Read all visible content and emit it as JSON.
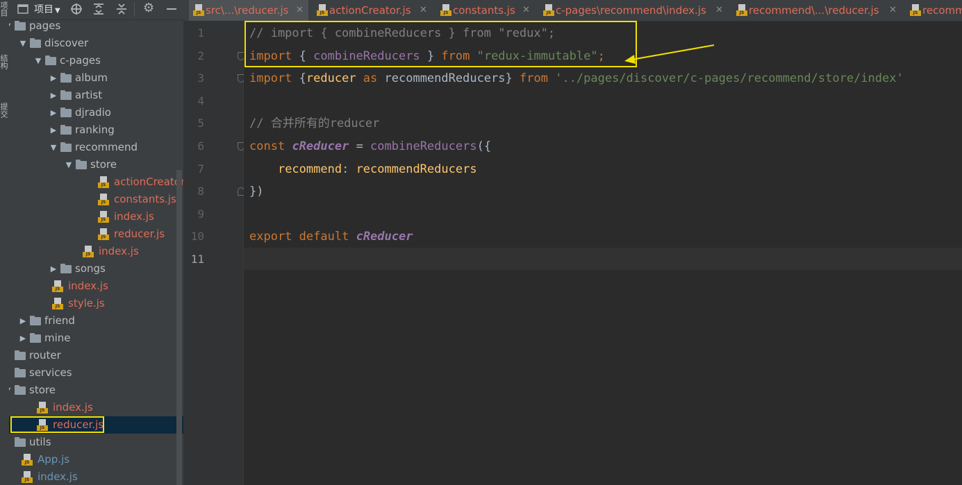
{
  "side_strip": {
    "project_label": "项目",
    "structure_label": "结构",
    "commit_label": "提交"
  },
  "project_panel": {
    "view_selector": "项目",
    "tree": [
      {
        "label": "pages",
        "kind": "folder",
        "depth": 0,
        "state": "open"
      },
      {
        "label": "discover",
        "kind": "folder",
        "depth": 1,
        "state": "open"
      },
      {
        "label": "c-pages",
        "kind": "folder",
        "depth": 2,
        "state": "open"
      },
      {
        "label": "album",
        "kind": "folder",
        "depth": 3,
        "state": "closed"
      },
      {
        "label": "artist",
        "kind": "folder",
        "depth": 3,
        "state": "closed"
      },
      {
        "label": "djradio",
        "kind": "folder",
        "depth": 3,
        "state": "closed"
      },
      {
        "label": "ranking",
        "kind": "folder",
        "depth": 3,
        "state": "closed"
      },
      {
        "label": "recommend",
        "kind": "folder",
        "depth": 3,
        "state": "open"
      },
      {
        "label": "store",
        "kind": "folder",
        "depth": 4,
        "state": "open"
      },
      {
        "label": "actionCreator.js",
        "kind": "js",
        "depth": 5
      },
      {
        "label": "constants.js",
        "kind": "js",
        "depth": 5
      },
      {
        "label": "index.js",
        "kind": "js",
        "depth": 5
      },
      {
        "label": "reducer.js",
        "kind": "js",
        "depth": 5
      },
      {
        "label": "index.js",
        "kind": "js",
        "depth": 4
      },
      {
        "label": "songs",
        "kind": "folder",
        "depth": 3,
        "state": "closed"
      },
      {
        "label": "index.js",
        "kind": "js",
        "depth": 2
      },
      {
        "label": "style.js",
        "kind": "js",
        "depth": 2
      },
      {
        "label": "friend",
        "kind": "folder",
        "depth": 1,
        "state": "closed"
      },
      {
        "label": "mine",
        "kind": "folder",
        "depth": 1,
        "state": "closed"
      },
      {
        "label": "router",
        "kind": "folder",
        "depth": 0,
        "state": "none"
      },
      {
        "label": "services",
        "kind": "folder",
        "depth": 0,
        "state": "none"
      },
      {
        "label": "store",
        "kind": "folder",
        "depth": 0,
        "state": "open"
      },
      {
        "label": "index.js",
        "kind": "js",
        "depth": 1
      },
      {
        "label": "reducer.js",
        "kind": "js",
        "depth": 1,
        "selected": true
      },
      {
        "label": "utils",
        "kind": "folder",
        "depth": 0,
        "state": "none"
      },
      {
        "label": "App.js",
        "kind": "jsb",
        "depth": 0
      },
      {
        "label": "index.js",
        "kind": "jsb",
        "depth": 0
      }
    ]
  },
  "tabs": [
    {
      "label": "src\\...\\reducer.js",
      "active": true
    },
    {
      "label": "actionCreator.js",
      "active": false
    },
    {
      "label": "constants.js",
      "active": false
    },
    {
      "label": "c-pages\\recommend\\index.js",
      "active": false
    },
    {
      "label": "recommend\\...\\reducer.js",
      "active": false
    },
    {
      "label": "recomm",
      "active": false
    }
  ],
  "editor": {
    "current_line": 11,
    "lines": [
      {
        "n": "1",
        "tokens": [
          {
            "t": "// import { combineReducers } from \"redux\";",
            "c": "cm"
          }
        ]
      },
      {
        "n": "2",
        "tokens": [
          {
            "t": "import",
            "c": "kw"
          },
          {
            "t": " { ",
            "c": "txt"
          },
          {
            "t": "combineReducers",
            "c": "fn"
          },
          {
            "t": " } ",
            "c": "txt"
          },
          {
            "t": "from",
            "c": "kw"
          },
          {
            "t": " ",
            "c": "txt"
          },
          {
            "t": "\"redux-immutable\"",
            "c": "str"
          },
          {
            "t": ";",
            "c": "kw"
          }
        ]
      },
      {
        "n": "3",
        "tokens": [
          {
            "t": "import",
            "c": "kw"
          },
          {
            "t": " {",
            "c": "txt"
          },
          {
            "t": "reducer",
            "c": "prop"
          },
          {
            "t": " as ",
            "c": "kw"
          },
          {
            "t": "recommendReducers",
            "c": "txt"
          },
          {
            "t": "} ",
            "c": "txt"
          },
          {
            "t": "from",
            "c": "kw"
          },
          {
            "t": " ",
            "c": "txt"
          },
          {
            "t": "'../pages/discover/c-pages/recommend/store/index'",
            "c": "str"
          }
        ]
      },
      {
        "n": "4",
        "tokens": []
      },
      {
        "n": "5",
        "tokens": [
          {
            "t": "// 合并所有的reducer",
            "c": "cm"
          }
        ]
      },
      {
        "n": "6",
        "tokens": [
          {
            "t": "const",
            "c": "kw"
          },
          {
            "t": " ",
            "c": "txt"
          },
          {
            "t": "cReducer",
            "c": "var"
          },
          {
            "t": " = ",
            "c": "txt"
          },
          {
            "t": "combineReducers",
            "c": "fn"
          },
          {
            "t": "({",
            "c": "txt"
          }
        ]
      },
      {
        "n": "7",
        "tokens": [
          {
            "t": "    ",
            "c": "txt"
          },
          {
            "t": "recommend",
            "c": "prop"
          },
          {
            "t": ": ",
            "c": "txt"
          },
          {
            "t": "recommendReducers",
            "c": "prop"
          }
        ]
      },
      {
        "n": "8",
        "tokens": [
          {
            "t": "})",
            "c": "txt"
          }
        ]
      },
      {
        "n": "9",
        "tokens": []
      },
      {
        "n": "10",
        "tokens": [
          {
            "t": "export",
            "c": "kw"
          },
          {
            "t": " ",
            "c": "txt"
          },
          {
            "t": "default",
            "c": "kw"
          },
          {
            "t": " ",
            "c": "txt"
          },
          {
            "t": "cReducer",
            "c": "var"
          }
        ]
      },
      {
        "n": "11",
        "tokens": []
      }
    ]
  },
  "colors": {
    "annotation": "#f0e000",
    "js_file": "#e06c58",
    "root_js_file": "#6897bb"
  }
}
